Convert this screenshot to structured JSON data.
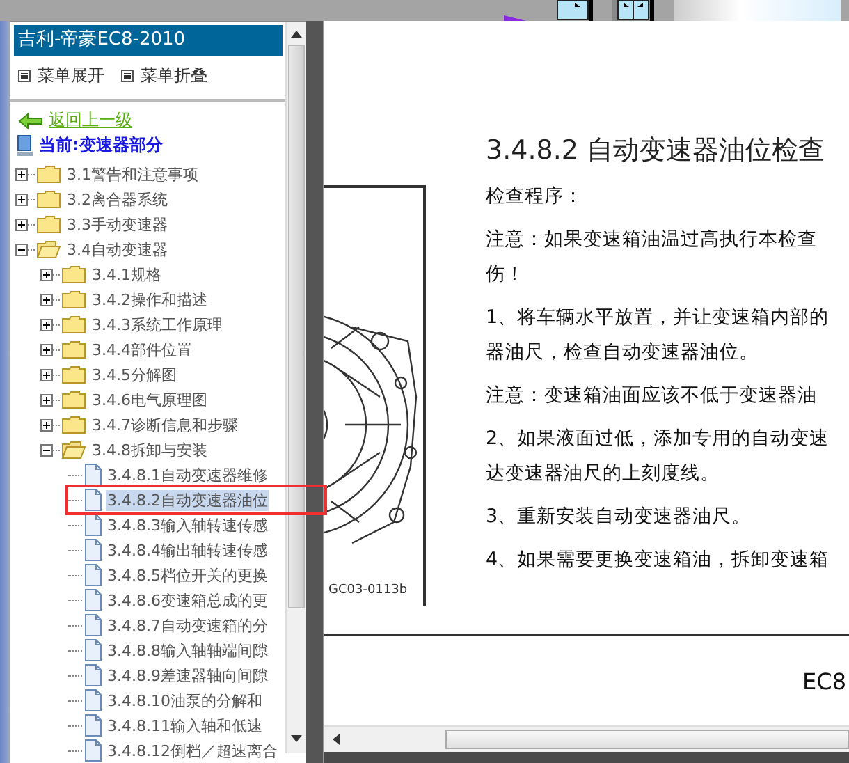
{
  "window": {
    "title": "吉利-帝豪EC8-2010"
  },
  "menu_buttons": [
    {
      "label": "菜单展开"
    },
    {
      "label": "菜单折叠"
    }
  ],
  "back_link": {
    "label": "返回上一级"
  },
  "current_section": {
    "label": "当前:变速器部分"
  },
  "tree": [
    {
      "kind": "folder",
      "label": "3.1警告和注意事项",
      "expanded": false,
      "selected": false
    },
    {
      "kind": "folder",
      "label": "3.2离合器系统",
      "expanded": false,
      "selected": false
    },
    {
      "kind": "folder",
      "label": "3.3手动变速器",
      "expanded": false,
      "selected": false
    },
    {
      "kind": "folder",
      "label": "3.4自动变速器",
      "expanded": true,
      "selected": false,
      "children": [
        {
          "kind": "folder",
          "label": "3.4.1规格",
          "expanded": false,
          "selected": false
        },
        {
          "kind": "folder",
          "label": "3.4.2操作和描述",
          "expanded": false,
          "selected": false
        },
        {
          "kind": "folder",
          "label": "3.4.3系统工作原理",
          "expanded": false,
          "selected": false
        },
        {
          "kind": "folder",
          "label": "3.4.4部件位置",
          "expanded": false,
          "selected": false
        },
        {
          "kind": "folder",
          "label": "3.4.5分解图",
          "expanded": false,
          "selected": false
        },
        {
          "kind": "folder",
          "label": "3.4.6电气原理图",
          "expanded": false,
          "selected": false
        },
        {
          "kind": "folder",
          "label": "3.4.7诊断信息和步骤",
          "expanded": false,
          "selected": false
        },
        {
          "kind": "folder",
          "label": "3.4.8拆卸与安装",
          "expanded": true,
          "selected": false,
          "children": [
            {
              "kind": "page",
              "label": "3.4.8.1自动变速器维修",
              "selected": false
            },
            {
              "kind": "page",
              "label": "3.4.8.2自动变速器油位",
              "selected": true
            },
            {
              "kind": "page",
              "label": "3.4.8.3输入轴转速传感",
              "selected": false
            },
            {
              "kind": "page",
              "label": "3.4.8.4输出轴转速传感",
              "selected": false
            },
            {
              "kind": "page",
              "label": "3.4.8.5档位开关的更换",
              "selected": false
            },
            {
              "kind": "page",
              "label": "3.4.8.6变速箱总成的更",
              "selected": false
            },
            {
              "kind": "page",
              "label": "3.4.8.7自动变速箱的分",
              "selected": false
            },
            {
              "kind": "page",
              "label": "3.4.8.8输入轴轴端间隙",
              "selected": false
            },
            {
              "kind": "page",
              "label": "3.4.8.9差速器轴向间隙",
              "selected": false
            },
            {
              "kind": "page",
              "label": "3.4.8.10油泵的分解和",
              "selected": false
            },
            {
              "kind": "page",
              "label": "3.4.8.11输入轴和低速",
              "selected": false
            },
            {
              "kind": "page",
              "label": "3.4.8.12倒档／超速离合",
              "selected": false
            }
          ]
        }
      ]
    }
  ],
  "document": {
    "heading": "3.4.8.2 自动变速器油位检查",
    "paragraphs": [
      [
        "检查程序："
      ],
      [
        "注意：如果变速箱油温过高执行本检查",
        "伤！"
      ],
      [
        "1、将车辆水平放置，并让变速箱内部的",
        "器油尺，检查自动变速器油位。"
      ],
      [
        "注意：变速箱油面应该不低于变速器油"
      ],
      [
        "2、如果液面过低，添加专用的自动变速",
        "达变速器油尺的上刻度线。"
      ],
      [
        "3、重新安装自动变速器油尺。"
      ],
      [
        "4、如果需要更换变速箱油，拆卸变速箱"
      ]
    ],
    "figure": {
      "caption": "GC03-0113b"
    },
    "footer": "EC8"
  }
}
